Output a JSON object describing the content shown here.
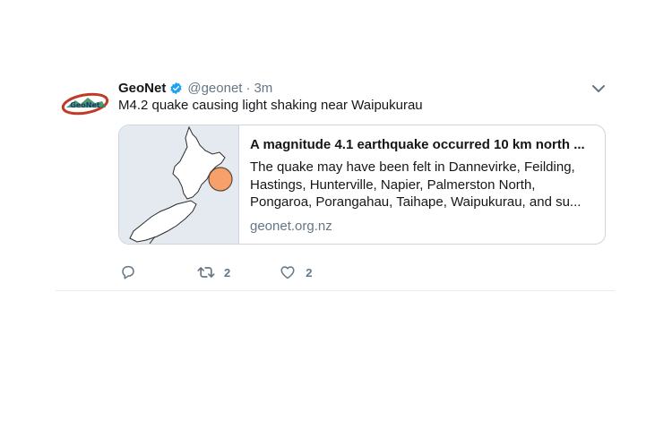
{
  "tweet": {
    "author_name": "GeoNet",
    "handle": "@geonet",
    "separator": "·",
    "time": "3m",
    "text": "M4.2 quake causing light shaking near Waipukurau",
    "avatar_text": "GeoNet"
  },
  "card": {
    "title": "A magnitude 4.1 earthquake occurred 10 km north ...",
    "description": "The quake may have been felt in Dannevirke, Feilding, Hastings, Hunterville, Napier, Palmerston North, Pongaroa, Porangahau, Taihape, Waipukurau, and su...",
    "domain": "geonet.org.nz",
    "marker_color": "#f8a06b"
  },
  "actions": {
    "retweet_count": "2",
    "like_count": "2"
  },
  "colors": {
    "verified": "#1da1f2",
    "muted": "#657786",
    "divider": "#e6ecf0"
  }
}
